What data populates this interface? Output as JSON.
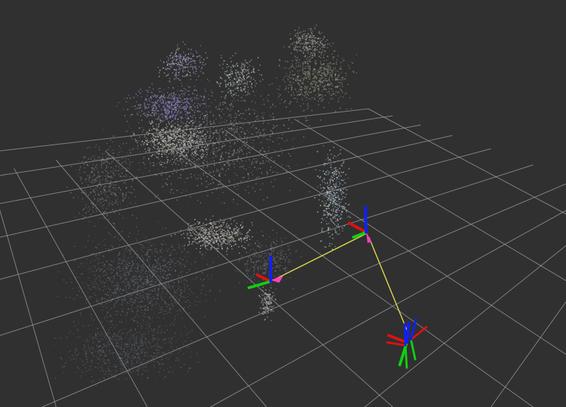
{
  "scene": {
    "background": "#303030",
    "grid": {
      "visible": true,
      "line_color": "#a0a0a4"
    },
    "point_cloud": {
      "colors": [
        "#c8c8c8",
        "#8a8a9a",
        "#9d98b8",
        "#6c78c8",
        "#9b7fd4",
        "#b8d8e8",
        "#8e9a6e",
        "#a6a08a",
        "#b0b0b0",
        "#7c8a98",
        "#5c6470"
      ]
    },
    "frames": [
      {
        "id": "frame-left",
        "axis_colors": {
          "x": "#e01010",
          "y": "#10d010",
          "z": "#1020ff"
        }
      },
      {
        "id": "frame-center",
        "axis_colors": {
          "x": "#e01010",
          "y": "#10d010",
          "z": "#1020ff"
        }
      },
      {
        "id": "frame-lower-right",
        "axis_colors": {
          "x": "#e01010",
          "y": "#10d010",
          "z": "#1020ff"
        }
      }
    ],
    "links": {
      "color": "#d8d850",
      "arrow_color": "#ff40c0"
    }
  }
}
